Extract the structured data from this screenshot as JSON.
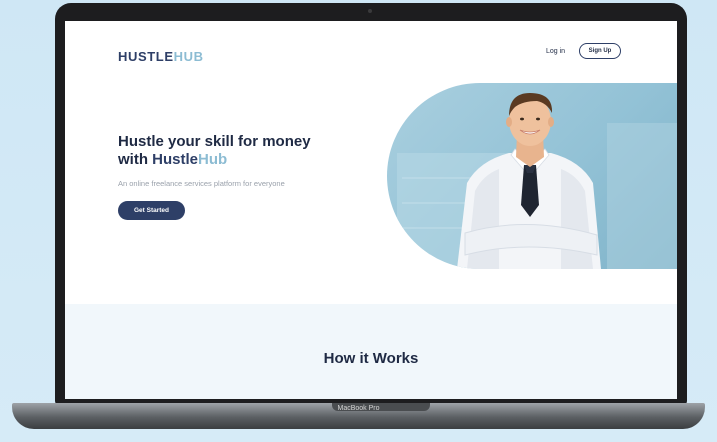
{
  "header": {
    "logo_main": "HUSTLE",
    "logo_accent": "HUB",
    "login_label": "Log in",
    "signup_label": "Sign Up"
  },
  "hero": {
    "title_line1": "Hustle your skill for money",
    "title_with": "with ",
    "title_brand_main": "Hustle",
    "title_brand_accent": "Hub",
    "subtitle": "An online freelance services platform for everyone",
    "cta_label": "Get Started"
  },
  "how": {
    "title": "How it Works"
  },
  "device": {
    "label": "MacBook Pro"
  },
  "colors": {
    "brand_dark": "#2e3f67",
    "brand_accent": "#8cbcd3",
    "page_bg": "#d6ebf7",
    "section_bg": "#f1f7fb"
  },
  "icons": {
    "hero_image": "smiling-businessman-photo"
  }
}
